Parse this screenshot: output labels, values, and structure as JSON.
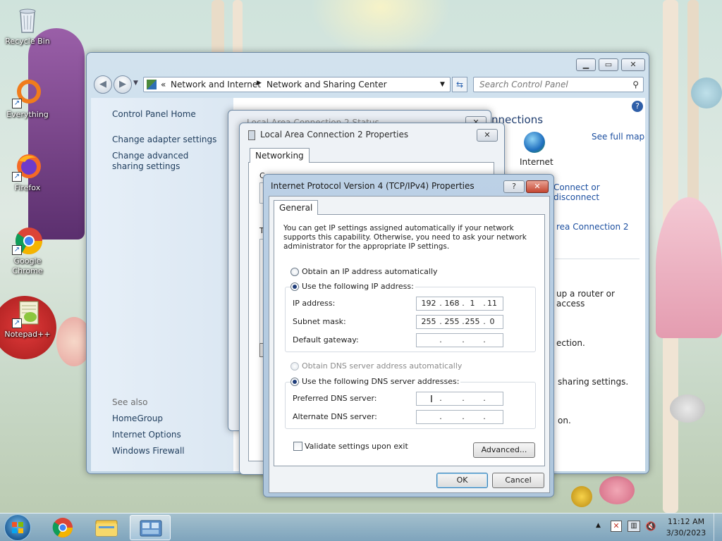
{
  "desktop": {
    "icons": [
      {
        "label": "Recycle Bin"
      },
      {
        "label": "Everything"
      },
      {
        "label": "Firefox"
      },
      {
        "label": "Google Chrome"
      },
      {
        "label": "Notepad++"
      }
    ]
  },
  "explorer": {
    "breadcrumb": {
      "chevrons": "«",
      "part1": "Network and Internet",
      "part2": "Network and Sharing Center"
    },
    "search_placeholder": "Search Control Panel",
    "left_pane": {
      "home": "Control Panel Home",
      "change_adapter": "Change adapter settings",
      "change_sharing": "Change advanced sharing settings",
      "see_also": "See also",
      "homegroup": "HomeGroup",
      "internet_options": "Internet Options",
      "windows_firewall": "Windows Firewall"
    },
    "main_pane": {
      "connections_fragment": "nnections",
      "see_full_map": "See full map",
      "internet_label": "Internet",
      "connect_disconnect": "Connect or disconnect",
      "area_connection_2": "rea Connection 2",
      "router_text": "up a router or access",
      "ection_text": "ection.",
      "sharing_text": "sharing settings.",
      "on_text": "on."
    }
  },
  "lac_status": {
    "title": "Local Area Connection 2 Status"
  },
  "lac_properties": {
    "title": "Local Area Connection 2 Properties",
    "tab_networking": "Networking",
    "fragment_c": "C",
    "fragment_t": "T"
  },
  "ipv4": {
    "title": "Internet Protocol Version 4 (TCP/IPv4) Properties",
    "help_glyph": "?",
    "close_glyph": "✕",
    "tab_general": "General",
    "intro": "You can get IP settings assigned automatically if your network supports this capability. Otherwise, you need to ask your network administrator for the appropriate IP settings.",
    "obtain_ip_auto": "Obtain an IP address automatically",
    "use_following_ip": "Use the following IP address:",
    "ip_address_label": "IP address:",
    "ip_address": [
      "192",
      "168",
      "1",
      "11"
    ],
    "subnet_label": "Subnet mask:",
    "subnet": [
      "255",
      "255",
      "255",
      "0"
    ],
    "gateway_label": "Default gateway:",
    "obtain_dns_auto": "Obtain DNS server address automatically",
    "use_following_dns": "Use the following DNS server addresses:",
    "preferred_dns_label": "Preferred DNS server:",
    "alternate_dns_label": "Alternate DNS server:",
    "validate_label": "Validate settings upon exit",
    "advanced_button": "Advanced...",
    "ok_button": "OK",
    "cancel_button": "Cancel",
    "selection": {
      "ip_mode": "manual",
      "dns_mode": "manual",
      "validate_checked": false
    }
  },
  "taskbar": {
    "clock_time": "11:12 AM",
    "clock_date": "3/30/2023"
  },
  "colors": {
    "link": "#1c4fa0",
    "accent": "#3c7fb1"
  }
}
